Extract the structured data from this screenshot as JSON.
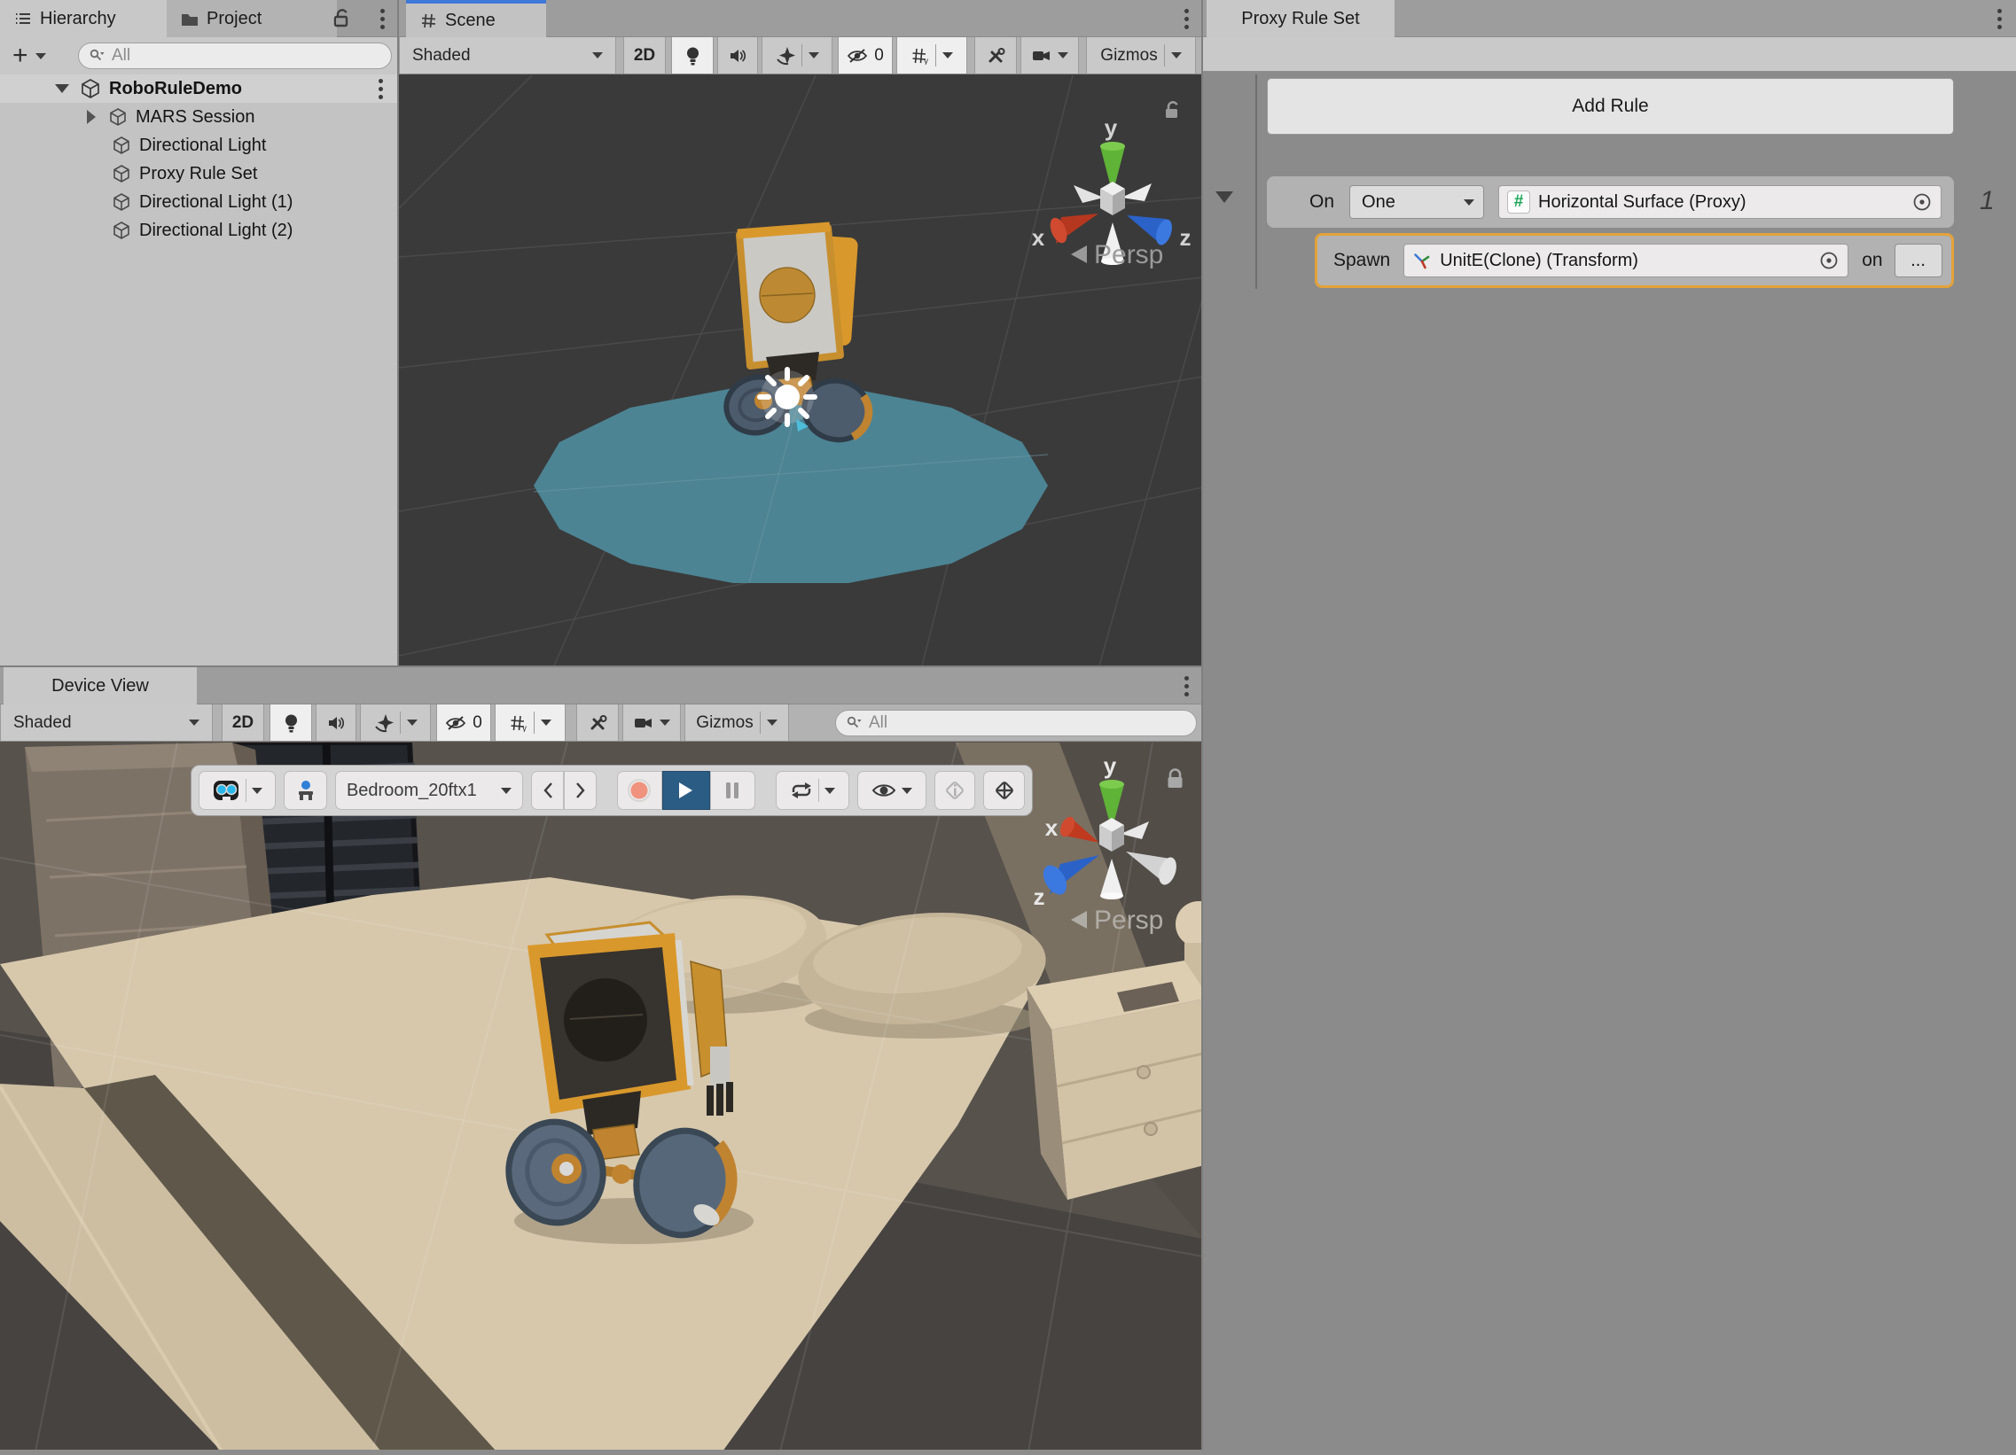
{
  "colors": {
    "focus_blue": "#3e78d8",
    "play_button_blue": "#2b5c84",
    "record_salmon": "#f0937e",
    "proxy_surface_teal": "#4c8494",
    "rule_highlight_orange": "#e3a23a"
  },
  "hierarchy": {
    "tab": "Hierarchy",
    "project_tab": "Project",
    "create_button": "+",
    "search": "All",
    "items": [
      {
        "label": "RoboRuleDemo"
      },
      {
        "label": "MARS Session"
      },
      {
        "label": "Directional Light"
      },
      {
        "label": "Proxy Rule Set"
      },
      {
        "label": "Directional Light (1)"
      },
      {
        "label": "Directional Light (2)"
      }
    ]
  },
  "scene_view": {
    "tab": "Scene",
    "toolbar": {
      "shading": "Shaded",
      "mode_2d": "2D",
      "hidden_objects_count": "0",
      "gizmos": "Gizmos"
    },
    "overlay": {
      "axis": {
        "x": "x",
        "y": "y",
        "z": "z"
      },
      "projection": "Persp"
    }
  },
  "device_view": {
    "tab": "Device View",
    "toolbar": {
      "shading": "Shaded",
      "mode_2d": "2D",
      "hidden_objects_count": "0",
      "gizmos": "Gizmos",
      "search": "All"
    },
    "simulation": {
      "environment": "Bedroom_20ftx1"
    },
    "overlay": {
      "axis": {
        "x": "x",
        "y": "y",
        "z": "z"
      },
      "projection": "Persp"
    }
  },
  "proxy_rule_set": {
    "tab": "Proxy Rule Set",
    "add_rule_button": "Add Rule",
    "rules": [
      {
        "index": "1",
        "on_label": "On",
        "quantifier": "One",
        "condition": "Horizontal Surface (Proxy)",
        "condition_icon": "#",
        "action_label": "Spawn",
        "action_object": "UnitE(Clone) (Transform)",
        "suffix_label": "on",
        "more_button": "..."
      }
    ]
  }
}
